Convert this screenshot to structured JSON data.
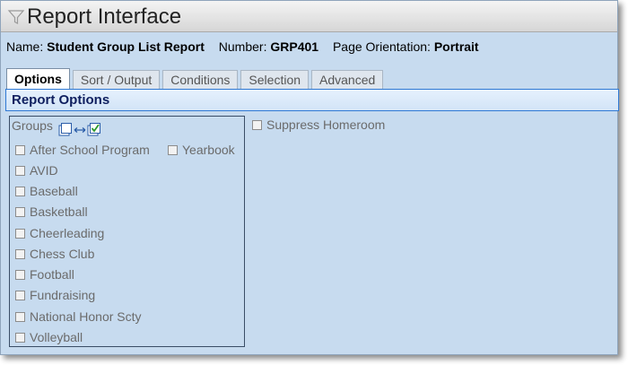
{
  "window": {
    "title": "Report Interface"
  },
  "info": {
    "name_label": "Name:",
    "name_value": "Student Group List Report",
    "number_label": "Number:",
    "number_value": "GRP401",
    "orientation_label": "Page Orientation:",
    "orientation_value": "Portrait"
  },
  "tabs": [
    {
      "label": "Options",
      "active": true
    },
    {
      "label": "Sort / Output",
      "active": false
    },
    {
      "label": "Conditions",
      "active": false
    },
    {
      "label": "Selection",
      "active": false
    },
    {
      "label": "Advanced",
      "active": false
    }
  ],
  "section": {
    "title": "Report Options"
  },
  "groups": {
    "label": "Groups",
    "items": [
      {
        "label": "After School Program",
        "checked": false
      },
      {
        "label": "Yearbook",
        "checked": false
      },
      {
        "label": "AVID",
        "checked": false
      },
      {
        "label": "Baseball",
        "checked": false
      },
      {
        "label": "Basketball",
        "checked": false
      },
      {
        "label": "Cheerleading",
        "checked": false
      },
      {
        "label": "Chess Club",
        "checked": false
      },
      {
        "label": "Football",
        "checked": false
      },
      {
        "label": "Fundraising",
        "checked": false
      },
      {
        "label": "National Honor Scty",
        "checked": false
      },
      {
        "label": "Volleyball",
        "checked": false
      }
    ]
  },
  "suppress_homeroom": {
    "label": "Suppress Homeroom",
    "checked": false
  },
  "colors": {
    "panel_bg": "#c7dbef",
    "section_border": "#2f79d4",
    "section_text": "#102060"
  }
}
